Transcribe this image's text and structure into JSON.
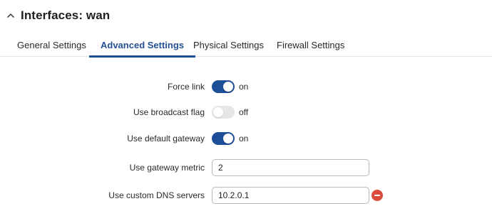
{
  "header": {
    "title": "Interfaces: wan",
    "collapse_icon": "chevron-up-icon"
  },
  "tabs": [
    {
      "label": "General Settings",
      "active": false
    },
    {
      "label": "Advanced Settings",
      "active": true
    },
    {
      "label": "Physical Settings",
      "active": false
    },
    {
      "label": "Firewall Settings",
      "active": false
    }
  ],
  "form": {
    "force_link": {
      "label": "Force link",
      "state": "on"
    },
    "broadcast_flag": {
      "label": "Use broadcast flag",
      "state": "off"
    },
    "default_gateway": {
      "label": "Use default gateway",
      "state": "on"
    },
    "gateway_metric": {
      "label": "Use gateway metric",
      "value": "2"
    },
    "custom_dns": {
      "label": "Use custom DNS servers",
      "value": "10.2.0.1",
      "remove_icon": "remove-circle-icon"
    }
  },
  "colors": {
    "accent": "#1d4e98",
    "toggle_off": "#e6e6e6",
    "remove": "#d94c3b"
  }
}
